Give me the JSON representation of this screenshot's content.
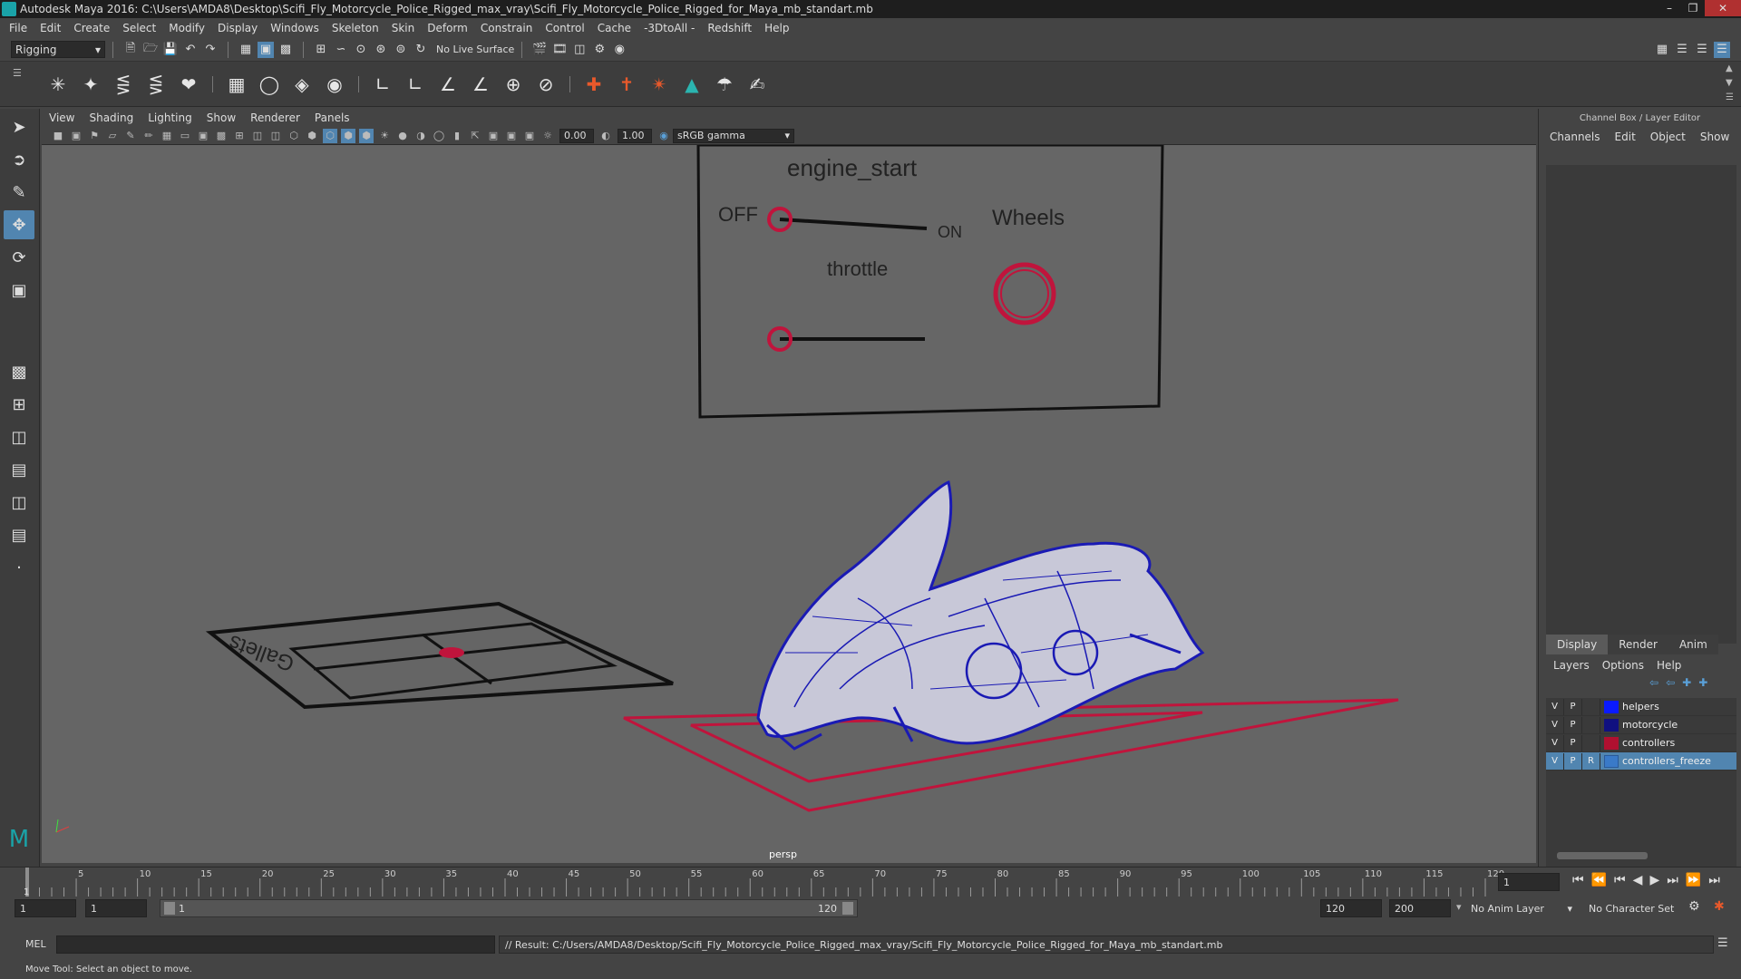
{
  "window": {
    "title": "Autodesk Maya 2016: C:\\Users\\AMDA8\\Desktop\\Scifi_Fly_Motorcycle_Police_Rigged_max_vray\\Scifi_Fly_Motorcycle_Police_Rigged_for_Maya_mb_standart.mb"
  },
  "menu": [
    "File",
    "Edit",
    "Create",
    "Select",
    "Modify",
    "Display",
    "Windows",
    "Skeleton",
    "Skin",
    "Deform",
    "Constrain",
    "Control",
    "Cache",
    "-3DtoAll -",
    "Redshift",
    "Help"
  ],
  "status": {
    "mode": "Rigging",
    "live_surface": "No Live Surface"
  },
  "panel_menu": [
    "View",
    "Shading",
    "Lighting",
    "Show",
    "Renderer",
    "Panels"
  ],
  "panel_toolbar": {
    "exposure": "0.00",
    "gamma": "1.00",
    "colorspace": "sRGB gamma"
  },
  "viewport": {
    "camera_label": "persp",
    "controls": {
      "engine_label": "engine_start",
      "off_label": "OFF",
      "on_label": "ON",
      "wheels_label": "Wheels",
      "throttle_label": "throttle"
    },
    "ground_text": "Gallets"
  },
  "right_panel": {
    "header": "Channel Box / Layer Editor",
    "channel_menu": [
      "Channels",
      "Edit",
      "Object",
      "Show"
    ],
    "layer_tabs": [
      "Display",
      "Render",
      "Anim"
    ],
    "layer_menu": [
      "Layers",
      "Options",
      "Help"
    ],
    "layers": [
      {
        "v": "V",
        "p": "P",
        "r": "",
        "name": "helpers",
        "color": "#0a1aff"
      },
      {
        "v": "V",
        "p": "P",
        "r": "",
        "name": "motorcycle",
        "color": "#101080"
      },
      {
        "v": "V",
        "p": "P",
        "r": "",
        "name": "controllers",
        "color": "#b01030"
      },
      {
        "v": "V",
        "p": "P",
        "r": "R",
        "name": "controllers_freeze",
        "color": "#3a7ac8",
        "selected": true
      }
    ]
  },
  "timeline": {
    "ticks": [
      "5",
      "10",
      "15",
      "20",
      "25",
      "30",
      "35",
      "40",
      "45",
      "50",
      "55",
      "60",
      "65",
      "70",
      "75",
      "80",
      "85",
      "90",
      "95",
      "100",
      "105",
      "110",
      "115",
      "120"
    ],
    "current_frame": "1",
    "start_tick": "1"
  },
  "range": {
    "start": "1",
    "playback_start": "1",
    "slider_start": "1",
    "slider_end": "120",
    "playback_end": "120",
    "end": "200",
    "anim_layer": "No Anim Layer",
    "char_set": "No Character Set"
  },
  "mel": {
    "label": "MEL",
    "result": "// Result: C:/Users/AMDA8/Desktop/Scifi_Fly_Motorcycle_Police_Rigged_max_vray/Scifi_Fly_Motorcycle_Police_Rigged_for_Maya_mb_standart.mb"
  },
  "help_line": "Move Tool: Select an object to move."
}
